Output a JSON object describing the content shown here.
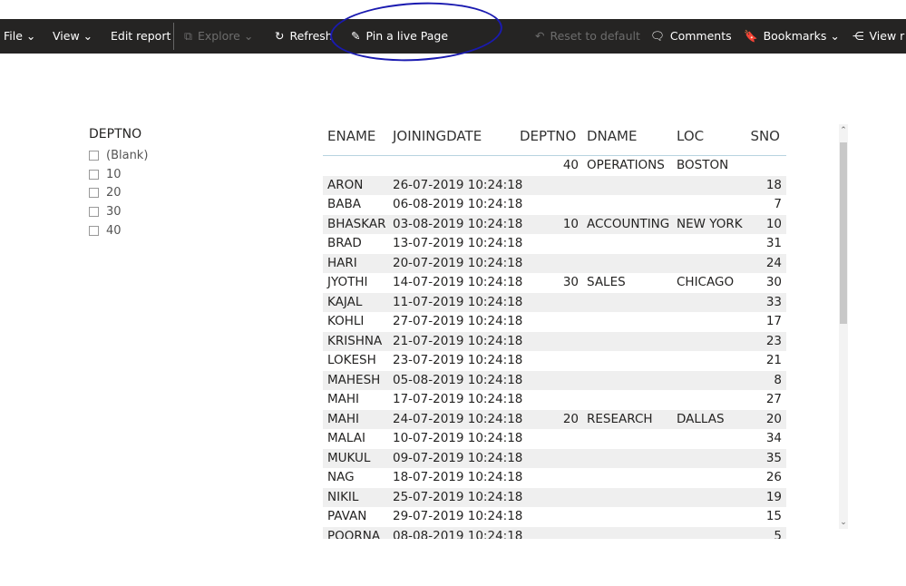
{
  "toolbar": {
    "file": "File",
    "view": "View",
    "edit_report": "Edit report",
    "explore": "Explore",
    "refresh": "Refresh",
    "pin": "Pin a live Page",
    "reset": "Reset to default",
    "comments": "Comments",
    "bookmarks": "Bookmarks",
    "view_related": "View r"
  },
  "slicer": {
    "title": "DEPTNO",
    "options": [
      "(Blank)",
      "10",
      "20",
      "30",
      "40"
    ]
  },
  "table": {
    "headers": [
      "ENAME",
      "JOININGDATE",
      "DEPTNO",
      "DNAME",
      "LOC",
      "SNO"
    ],
    "rows": [
      [
        "",
        "",
        "40",
        "OPERATIONS",
        "BOSTON",
        ""
      ],
      [
        "ARON",
        "26-07-2019 10:24:18",
        "",
        "",
        "",
        "18"
      ],
      [
        "BABA",
        "06-08-2019 10:24:18",
        "",
        "",
        "",
        "7"
      ],
      [
        "BHASKAR",
        "03-08-2019 10:24:18",
        "10",
        "ACCOUNTING",
        "NEW YORK",
        "10"
      ],
      [
        "BRAD",
        "13-07-2019 10:24:18",
        "",
        "",
        "",
        "31"
      ],
      [
        "HARI",
        "20-07-2019 10:24:18",
        "",
        "",
        "",
        "24"
      ],
      [
        "JYOTHI",
        "14-07-2019 10:24:18",
        "30",
        "SALES",
        "CHICAGO",
        "30"
      ],
      [
        "KAJAL",
        "11-07-2019 10:24:18",
        "",
        "",
        "",
        "33"
      ],
      [
        "KOHLI",
        "27-07-2019 10:24:18",
        "",
        "",
        "",
        "17"
      ],
      [
        "KRISHNA",
        "21-07-2019 10:24:18",
        "",
        "",
        "",
        "23"
      ],
      [
        "LOKESH",
        "23-07-2019 10:24:18",
        "",
        "",
        "",
        "21"
      ],
      [
        "MAHESH",
        "05-08-2019 10:24:18",
        "",
        "",
        "",
        "8"
      ],
      [
        "MAHI",
        "17-07-2019 10:24:18",
        "",
        "",
        "",
        "27"
      ],
      [
        "MAHI",
        "24-07-2019 10:24:18",
        "20",
        "RESEARCH",
        "DALLAS",
        "20"
      ],
      [
        "MALAI",
        "10-07-2019 10:24:18",
        "",
        "",
        "",
        "34"
      ],
      [
        "MUKUL",
        "09-07-2019 10:24:18",
        "",
        "",
        "",
        "35"
      ],
      [
        "NAG",
        "18-07-2019 10:24:18",
        "",
        "",
        "",
        "26"
      ],
      [
        "NIKIL",
        "25-07-2019 10:24:18",
        "",
        "",
        "",
        "19"
      ],
      [
        "PAVAN",
        "29-07-2019 10:24:18",
        "",
        "",
        "",
        "15"
      ],
      [
        "POORNA",
        "08-08-2019 10:24:18",
        "",
        "",
        "",
        "5"
      ]
    ]
  }
}
